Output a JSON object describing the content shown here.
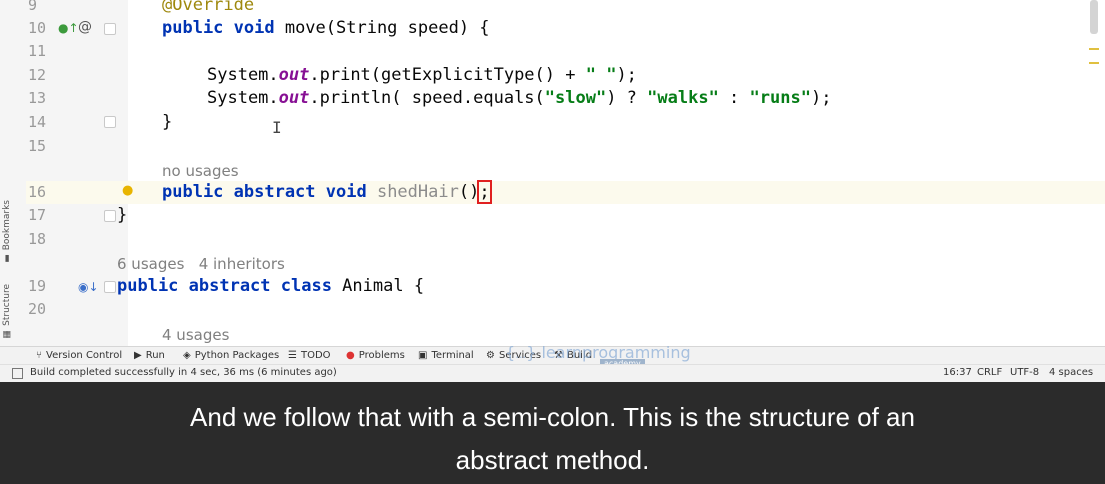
{
  "editor": {
    "lines": [
      {
        "num": "9"
      },
      {
        "num": "10"
      },
      {
        "num": "11"
      },
      {
        "num": "12"
      },
      {
        "num": "13"
      },
      {
        "num": "14"
      },
      {
        "num": "15"
      },
      {
        "num": "16"
      },
      {
        "num": "17"
      },
      {
        "num": "18"
      },
      {
        "num": "19"
      },
      {
        "num": "20"
      }
    ],
    "code": {
      "annotation": "@Override",
      "move_sig_kw": "public void",
      "move_sig_rest": " move(String speed) {",
      "print_pre": "System.",
      "print_out": "out",
      "print_rest": ".print(getExplicitType() + ",
      "print_str": "\" \"",
      "print_end": ");",
      "println_pre": "System.",
      "println_out": "out",
      "println_mid": ".println( speed.equals(",
      "str_slow": "\"slow\"",
      "println_q": ") ? ",
      "str_walks": "\"walks\"",
      "println_colon": " : ",
      "str_runs": "\"runs\"",
      "println_end": ");",
      "close_brace": "}",
      "abstract_kw": "public abstract void",
      "abstract_name": "shedHair",
      "abstract_parens": "()",
      "abstract_semi": ";",
      "class_close": "}",
      "class_kw": "public abstract class",
      "class_name": " Animal {"
    },
    "hints": {
      "no_usages": "no usages",
      "animal_usages": "6 usages",
      "animal_inheritors": "4 inheritors",
      "four_usages": "4 usages"
    }
  },
  "side_tabs": {
    "bookmarks": "Bookmarks",
    "structure": "Structure"
  },
  "toolbar": {
    "items": [
      {
        "label": "Version Control",
        "icon": "branch-icon"
      },
      {
        "label": "Run",
        "icon": "run-icon"
      },
      {
        "label": "Python Packages",
        "icon": "layers-icon"
      },
      {
        "label": "TODO",
        "icon": "list-icon"
      },
      {
        "label": "Problems",
        "icon": "error-icon"
      },
      {
        "label": "Terminal",
        "icon": "terminal-icon"
      },
      {
        "label": "Services",
        "icon": "services-icon"
      },
      {
        "label": "Build",
        "icon": "hammer-icon"
      }
    ]
  },
  "watermark": {
    "brand": "learnprogramming",
    "sub": "academy"
  },
  "status": {
    "message": "Build completed successfully in 4 sec, 36 ms (6 minutes ago)",
    "position": "16:37",
    "line_sep": "CRLF",
    "encoding": "UTF-8",
    "indent": "4 spaces"
  },
  "caption": {
    "line1": "And we follow that with a semi-colon. This is the structure of an",
    "line2": "abstract method."
  }
}
